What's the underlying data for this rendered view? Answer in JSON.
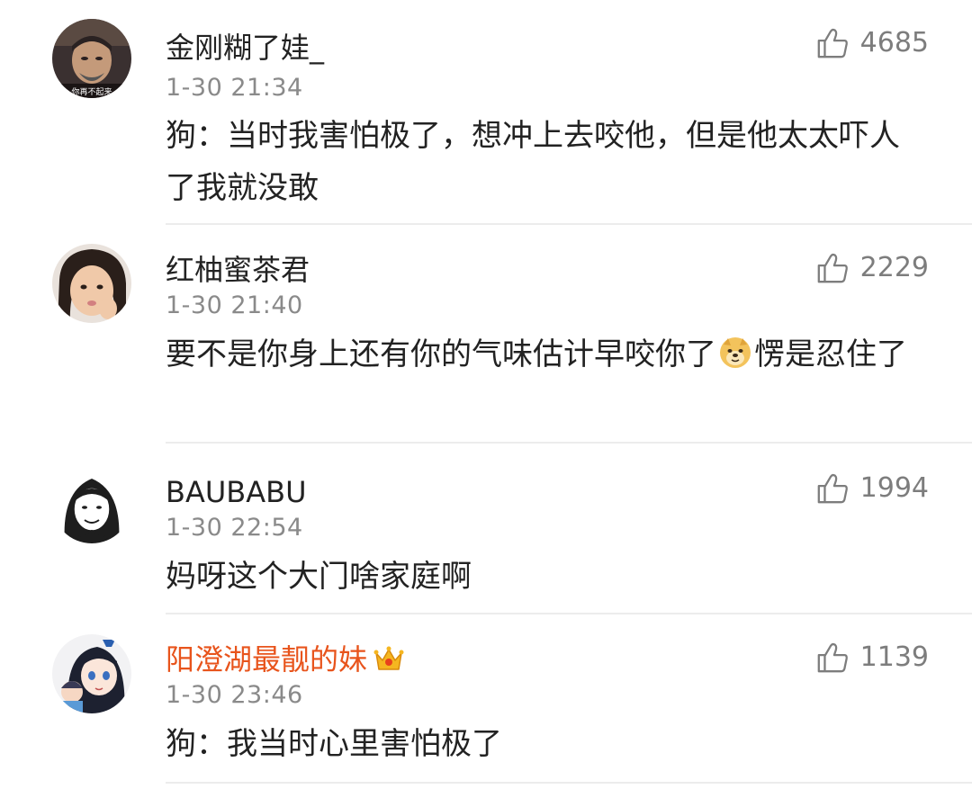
{
  "comments": [
    {
      "username": "金刚糊了娃_",
      "time": "1-30 21:34",
      "likes": "4685",
      "text_parts": [
        "狗：当时我害怕极了，想冲上去咬他，但是他太太吓人了我就没敢"
      ],
      "avatar_caption": "你再不起来"
    },
    {
      "username": "红柚蜜茶君",
      "time": "1-30 21:40",
      "likes": "2229",
      "text_parts": [
        "要不是你身上还有你的气味估计早咬你了",
        "愣是忍住了"
      ]
    },
    {
      "username": "BAUBABU",
      "time": "1-30 22:54",
      "likes": "1994",
      "text_parts": [
        "妈呀这个大门啥家庭啊"
      ]
    },
    {
      "username": "阳澄湖最靓的妹",
      "time": "1-30 23:46",
      "likes": "1139",
      "text_parts": [
        "狗：我当时心里害怕极了"
      ]
    }
  ],
  "colors": {
    "vip_name": "#e8541c",
    "timestamp": "#8a8a8a",
    "like": "#7d7d7d",
    "divider": "#ececec"
  },
  "icons": {
    "like": "thumbs-up-icon",
    "emoji": "doge-emoji-icon",
    "crown": "crown-badge-icon"
  }
}
